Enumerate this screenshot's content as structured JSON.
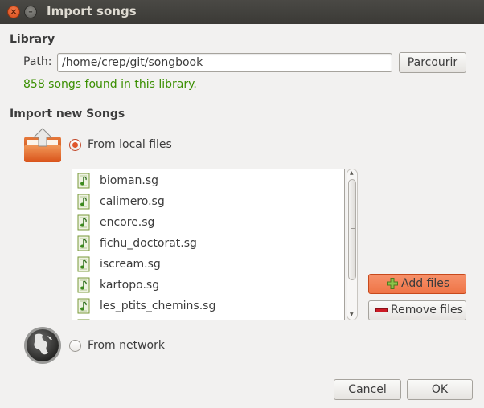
{
  "window": {
    "title": "Import songs",
    "close_glyph": "×",
    "minimize_glyph": "–"
  },
  "library": {
    "heading": "Library",
    "path_label": "Path:",
    "path_value": "/home/crep/git/songbook",
    "browse_label": "Parcourir",
    "status": "858 songs found in this library."
  },
  "import": {
    "heading": "Import new Songs",
    "local_option": "From local files",
    "network_option": "From network",
    "local_selected": true,
    "files": [
      "bioman.sg",
      "calimero.sg",
      "encore.sg",
      "fichu_doctorat.sg",
      "iscream.sg",
      "kartopo.sg",
      "les_ptits_chemins.sg"
    ],
    "add_label": "Add files",
    "remove_label": "Remove files"
  },
  "footer": {
    "cancel_mnemonic": "C",
    "cancel_rest": "ancel",
    "ok_mnemonic": "O",
    "ok_rest": "K"
  },
  "colors": {
    "accent": "#e0562b",
    "status_green": "#3a8f00",
    "titlebar": "#3b3a36"
  }
}
